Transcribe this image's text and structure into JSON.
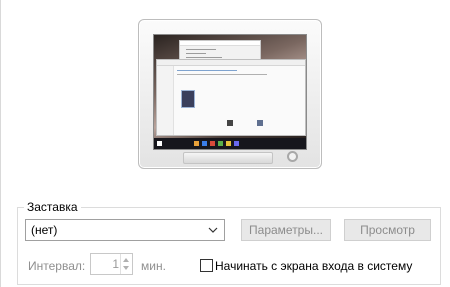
{
  "screensaver": {
    "group_title": "Заставка",
    "selected": "(нет)",
    "settings_button": "Параметры...",
    "preview_button": "Просмотр",
    "interval_label": "Интервал:",
    "interval_value": "1",
    "interval_unit": "мин.",
    "logon_checkbox_label": "Начинать с экрана входа в систему",
    "logon_checked": false
  },
  "monitor_preview": {
    "icon": "monitor-preview"
  },
  "colors": {
    "disabled_text": "#8c8c8c",
    "button_bg": "#e8e8e8",
    "group_border": "#dcdcdc"
  }
}
